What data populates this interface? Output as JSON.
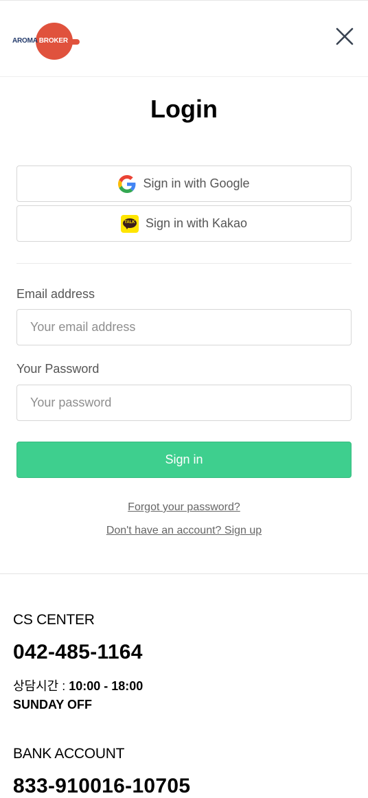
{
  "header": {
    "logo_text_1": "AROMA",
    "logo_text_2": "BROKER",
    "close_icon": "close-icon"
  },
  "title": "Login",
  "social": {
    "google_label": "Sign in with Google",
    "google_icon": "google-icon",
    "kakao_label": "Sign in with Kakao",
    "kakao_icon": "kakao-talk-icon",
    "kakao_icon_text": "TALK"
  },
  "form": {
    "email_label": "Email address",
    "email_placeholder": "Your email address",
    "email_value": "",
    "password_label": "Your Password",
    "password_placeholder": "Your password",
    "password_value": "",
    "submit_label": "Sign in"
  },
  "links": {
    "forgot": "Forgot your password?",
    "signup": "Don't have an account? Sign up"
  },
  "footer": {
    "cs_title": "CS CENTER",
    "cs_phone": "042-485-1164",
    "cs_hours_prefix": "상담시간 : ",
    "cs_hours": "10:00 - 18:00",
    "cs_off": "SUNDAY OFF",
    "bank_title": "BANK ACCOUNT",
    "bank_number": "833-910016-10705"
  },
  "colors": {
    "brand": "#e0523d",
    "brand_navy": "#233a6b",
    "primary_button": "#3ecf8e",
    "kakao_yellow": "#ffe500"
  }
}
